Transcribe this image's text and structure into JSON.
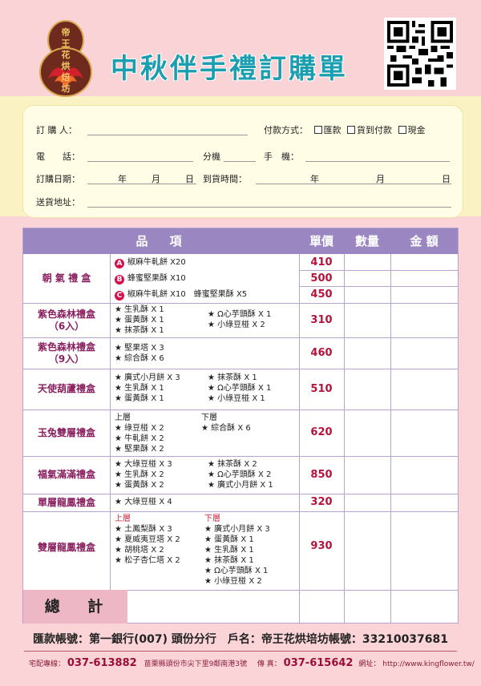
{
  "header": {
    "title": "中秋伴手禮訂購單",
    "logo_text": [
      "帝",
      "王",
      "花",
      "烘",
      "焙",
      "坊"
    ]
  },
  "form": {
    "orderer_label": "訂 購 人：",
    "payment_label": "付款方式：",
    "payment_options": [
      "匯款",
      "貨到付款",
      "現金"
    ],
    "phone_label": "電　　話：",
    "ext_label": "分機",
    "mobile_label": "手　機：",
    "order_date_label": "訂購日期：",
    "year": "年",
    "month": "月",
    "day": "日",
    "arrival_label": "到貨時間：",
    "address_label": "送貨地址："
  },
  "table": {
    "headers": {
      "item": "品　項",
      "price": "單價",
      "qty": "數量",
      "amount": "金 額"
    },
    "rows": [
      {
        "name": "朝 氣 禮 盒",
        "sub": "",
        "price_a": "410",
        "price_b": "500",
        "price_c": "450",
        "opt_a": "椒麻牛軋餅 X20",
        "opt_b": "蜂蜜堅果酥 X10",
        "opt_c1": "椒麻牛軋餅 X10",
        "opt_c2": "蜂蜜堅果酥 X5"
      },
      {
        "name": "紫色森林禮盒",
        "sub": "（6入）",
        "price": "310",
        "left": [
          "★ 生乳酥 X 1",
          "★ 蛋黃酥 X 1",
          "★ 抹茶酥 X 1"
        ],
        "right": [
          "★ Ω心芋頭酥 X 1",
          "★ 小綠豆椪 X 2"
        ]
      },
      {
        "name": "紫色森林禮盒",
        "sub": "（9入）",
        "price": "460",
        "left": [
          "★ 堅果塔 X 3",
          "★ 綜合酥 X 6"
        ],
        "right": []
      },
      {
        "name": "天使葫蘆禮盒",
        "sub": "",
        "price": "510",
        "left": [
          "★ 廣式小月餅 X 3",
          "★ 生乳酥 X 1",
          "★ 蛋黃酥 X 1"
        ],
        "right": [
          "★ 抹茶酥 X 1",
          "★ Ω心芋頭酥 X 1",
          "★ 小綠豆椪 X 1"
        ]
      },
      {
        "name": "玉兔雙層禮盒",
        "sub": "",
        "price": "620",
        "upper": "上層",
        "lower": "下層",
        "left": [
          "★ 綠豆椪 X 2",
          "★ 牛軋餅 X 2",
          "★ 堅果酥 X 2"
        ],
        "right": [
          "★ 綜合酥 X 6"
        ]
      },
      {
        "name": "福氣滿滿禮盒",
        "sub": "",
        "price": "850",
        "left": [
          "★ 大綠豆椪 X 3",
          "★ 生乳酥 X 2",
          "★ 蛋黃酥 X 2"
        ],
        "right": [
          "★ 抹茶酥 X 2",
          "★ Ω心芋頭酥 X 2",
          "★ 廣式小月餅 X 1"
        ]
      },
      {
        "name": "單層龍鳳禮盒",
        "sub": "",
        "price": "320",
        "left": [
          "★ 大綠豆椪 X 4"
        ],
        "right": []
      },
      {
        "name": "雙層龍鳳禮盒",
        "sub": "",
        "price": "930",
        "upper": "上層",
        "lower": "下層",
        "left": [
          "★ 土鳳梨酥 X 3",
          "★ 夏威夷豆塔 X 2",
          "★ 胡桃塔 X 2",
          "★ 松子杏仁塔 X 2"
        ],
        "right": [
          "★ 廣式小月餅 X 3",
          "★ 蛋黃酥 X 1",
          "★ 生乳酥 X 1",
          "★ 抹茶酥 X 1",
          "★ Ω心芋頭酥 X 1",
          "★ 小綠豆椪 X 2"
        ]
      }
    ],
    "total_label": "總 計"
  },
  "bank": {
    "text": "匯款帳號：第一銀行(007) 頭份分行　戶名：帝王花烘培坊帳號：33210037681"
  },
  "footer": {
    "hotline_label": "宅配專線：",
    "hotline": "037-613882",
    "address": "苗栗縣頭份市尖下里9鄰南港3號",
    "fax_label": "傳 真：",
    "fax": "037-615642",
    "web_label": "網址：",
    "web": "http://www.kingflower.tw/"
  },
  "colors": {
    "title": "#1b9fb0",
    "header_bg": "#9a87c1",
    "price": "#b5133b",
    "name": "#8a2060"
  }
}
